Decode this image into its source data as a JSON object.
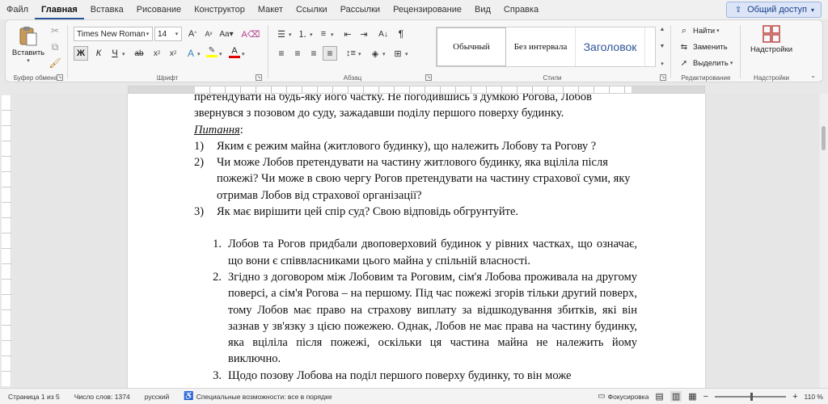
{
  "menu": {
    "tabs": [
      "Файл",
      "Главная",
      "Вставка",
      "Рисование",
      "Конструктор",
      "Макет",
      "Ссылки",
      "Рассылки",
      "Рецензирование",
      "Вид",
      "Справка"
    ],
    "active_tab": "Главная",
    "share_label": "Общий доступ"
  },
  "ribbon": {
    "clipboard": {
      "paste_label": "Вставить",
      "group_label": "Буфер обмена"
    },
    "font": {
      "font_name": "Times New Roman",
      "font_size": "14",
      "group_label": "Шрифт",
      "bold": "Ж",
      "italic": "К",
      "underline": "Ч"
    },
    "paragraph": {
      "group_label": "Абзац"
    },
    "styles": {
      "items": [
        "Обычный",
        "Без интервала",
        "Заголовок"
      ],
      "group_label": "Стили"
    },
    "editing": {
      "find_label": "Найти",
      "replace_label": "Заменить",
      "select_label": "Выделить",
      "group_label": "Редактирование"
    },
    "addins": {
      "label": "Надстройки",
      "group_label": "Надстройки"
    },
    "accent_color": "#c0504d",
    "highlight_color": "#ffff00",
    "font_color": "#e00000"
  },
  "document": {
    "para_top": "претендувати на будь-яку його частку. Не погодившись з думкою Рогова, Лобов звернувся з позовом до суду, зажадавши поділу першого поверху будинку.",
    "questions_heading": "Питання",
    "questions_colon": ":",
    "questions": [
      {
        "num": "1)",
        "text": "Яким є режим майна (житлового будинку), що належить Лобову та Рогову ?"
      },
      {
        "num": "2)",
        "text": "Чи може Лобов претендувати на частину житлового будинку, яка вціліла після пожежі? Чи може в свою чергу Рогов претендувати на частину страхової суми, яку отримав Лобов від страхової організації?"
      },
      {
        "num": "3)",
        "text": "Як має вирішити цей спір суд? Свою відповідь обгрунтуйте."
      }
    ],
    "answers": [
      {
        "num": "1.",
        "text": "Лобов та Рогов придбали двоповерховий будинок у рівних частках, що означає, що вони є співвласниками цього майна у спільній власності."
      },
      {
        "num": "2.",
        "text": "Згідно з договором між Лобовим та Роговим, сім'я Лобова проживала на другому поверсі, а сім'я Рогова – на першому. Під час пожежі згорів тільки другий поверх, тому Лобов має право на страхову виплату за відшкодування збитків, які він зазнав у зв'язку з цією пожежею. Однак, Лобов не має права на частину будинку, яка вціліла після пожежі, оскільки ця частина майна не належить йому виключно."
      },
      {
        "num": "3.",
        "text": "Щодо позову Лобова на поділ першого поверху будинку, то він може"
      }
    ]
  },
  "status": {
    "page": "Страница 1 из 5",
    "words": "Число слов: 1374",
    "language": "русский",
    "accessibility": "Специальные возможности: все в порядке",
    "focus": "Фокусировка",
    "zoom": "110 %",
    "zoom_percent": 110
  }
}
